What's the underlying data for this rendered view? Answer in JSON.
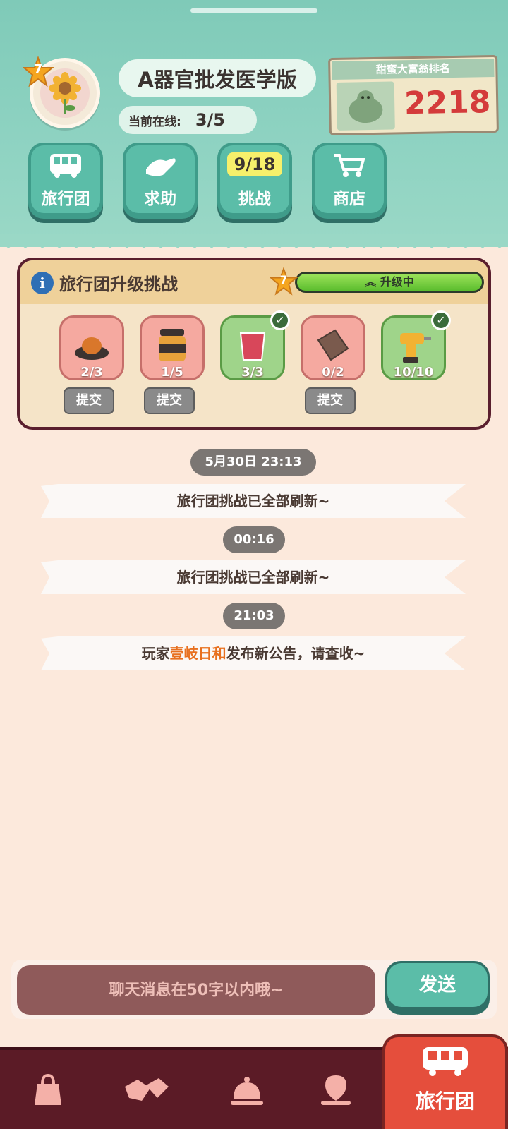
{
  "team": {
    "level": "7",
    "name": "A器官批发医学版",
    "online_label": "当前在线:",
    "online_value": "3/5"
  },
  "ranking": {
    "title": "甜蜜大富翁排名",
    "value": "2218"
  },
  "nav": [
    {
      "label": "旅行团",
      "icon": "bus-icon"
    },
    {
      "label": "求助",
      "icon": "hand-icon"
    },
    {
      "label": "挑战",
      "counter": "9/18"
    },
    {
      "label": "商店",
      "icon": "cart-icon"
    }
  ],
  "challenge": {
    "title": "旅行团升级挑战",
    "level": "7",
    "status": "升级中",
    "progress_percent": 100,
    "items": [
      {
        "name": "roast-dish",
        "count": "2/3",
        "done": false,
        "submit": "提交"
      },
      {
        "name": "caviar-jar",
        "count": "1/5",
        "done": false,
        "submit": "提交"
      },
      {
        "name": "red-drink",
        "count": "3/3",
        "done": true
      },
      {
        "name": "chocolate-bar",
        "count": "0/2",
        "done": false,
        "submit": "提交"
      },
      {
        "name": "drill",
        "count": "10/10",
        "done": true
      }
    ]
  },
  "messages": [
    {
      "time": "5月30日 23:13",
      "text": "旅行团挑战已全部刷新~"
    },
    {
      "time": "00:16",
      "text": "旅行团挑战已全部刷新~"
    },
    {
      "time": "21:03",
      "text_prefix": "玩家",
      "player": "壹岐日和",
      "text_suffix": "发布新公告，请查收~"
    }
  ],
  "input": {
    "placeholder": "聊天消息在50字以内哦~",
    "send_label": "发送"
  },
  "bottom_tabs": {
    "active_label": "旅行团"
  },
  "colors": {
    "header": "#8fd3c2",
    "accent_red": "#e54e3c",
    "highlight_player": "#e8701f",
    "bottom_bar": "#5b1b26"
  }
}
